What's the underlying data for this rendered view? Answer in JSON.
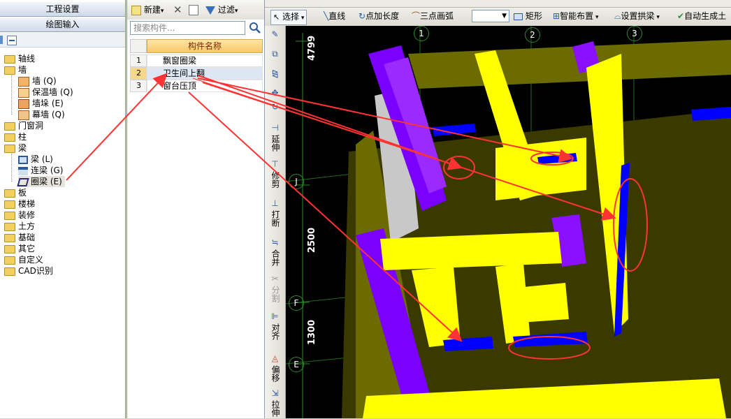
{
  "nav": {
    "header1": "工程设置",
    "header2": "绘图输入",
    "tree": {
      "axis": "轴线",
      "wall": "墙",
      "wall_children": [
        "墙 (Q)",
        "保温墙 (Q)",
        "墙垛 (E)",
        "幕墙 (Q)"
      ],
      "door_window": "门窗洞",
      "column": "柱",
      "beam": "梁",
      "beam_children": [
        "梁 (L)",
        "连梁 (G)",
        "圈梁 (E)"
      ],
      "slab": "板",
      "stair": "楼梯",
      "decoration": "装修",
      "earthwork": "土方",
      "foundation": "基础",
      "other": "其它",
      "custom": "自定义",
      "cad": "CAD识别"
    }
  },
  "list": {
    "new_label": "新建",
    "filter_label": "过滤",
    "search_placeholder": "搜索构件...",
    "column_header": "构件名称",
    "rows": [
      {
        "num": "1",
        "name": "飘窗圈梁"
      },
      {
        "num": "2",
        "name": "卫生间上翻"
      },
      {
        "num": "3",
        "name": "窗台压顶"
      }
    ]
  },
  "toolbar": {
    "select": "选择",
    "line": "直线",
    "point_length": "点加长度",
    "three_point_arc": "三点画弧",
    "rect": "矩形",
    "smart_place": "智能布置",
    "set_arch_beam": "设置拱梁",
    "auto_generate": "自动生成土"
  },
  "vtools": {
    "extend": "延伸",
    "trim": "修剪",
    "break": "打断",
    "merge": "合并",
    "split": "分割",
    "align": "对齐",
    "offset": "偏移",
    "stretch": "拉伸"
  },
  "canvas": {
    "axis_labels": [
      "1",
      "2",
      "3",
      "J",
      "F",
      "E"
    ],
    "dimensions": [
      "4799",
      "2500",
      "1300"
    ]
  },
  "colors": {
    "yellow": "#ffff00",
    "purple": "#7a00ff",
    "blue": "#0000ff",
    "olive": "#6b6b00",
    "annotation_red": "#ff3333"
  }
}
